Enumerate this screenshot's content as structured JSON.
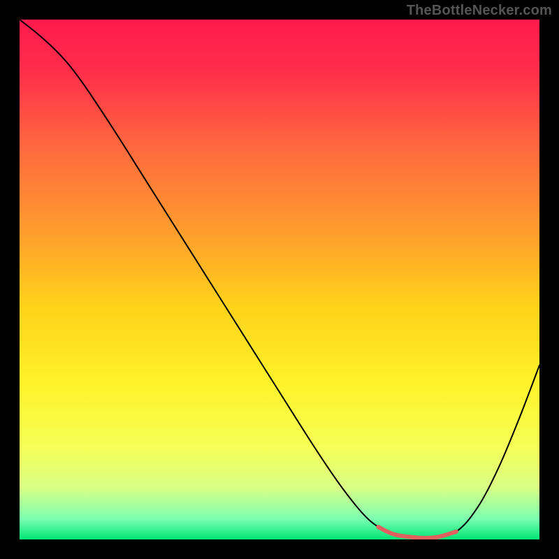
{
  "watermark": "TheBottleNecker.com",
  "chart_data": {
    "type": "line",
    "title": "",
    "xlabel": "",
    "ylabel": "",
    "xlim": [
      0,
      100
    ],
    "ylim": [
      0,
      100
    ],
    "background": {
      "gradient_stops": [
        {
          "offset": 0.0,
          "color": "#ff1a4d"
        },
        {
          "offset": 0.1,
          "color": "#ff2e4a"
        },
        {
          "offset": 0.25,
          "color": "#ff6a3e"
        },
        {
          "offset": 0.4,
          "color": "#ff9a2e"
        },
        {
          "offset": 0.55,
          "color": "#ffd21a"
        },
        {
          "offset": 0.7,
          "color": "#fff22a"
        },
        {
          "offset": 0.82,
          "color": "#f6ff55"
        },
        {
          "offset": 0.9,
          "color": "#d9ff85"
        },
        {
          "offset": 0.96,
          "color": "#7dffb0"
        },
        {
          "offset": 1.0,
          "color": "#00e676"
        }
      ]
    },
    "series": [
      {
        "name": "bottleneck-curve",
        "color": "#000000",
        "width": 2,
        "x": [
          0,
          4,
          8,
          12,
          18,
          24,
          30,
          36,
          42,
          48,
          54,
          58,
          62,
          66,
          69,
          72,
          76,
          80,
          84,
          88,
          92,
          96,
          100
        ],
        "y": [
          100,
          96.8,
          93.0,
          88.0,
          79.0,
          69.5,
          60.0,
          50.5,
          41.0,
          31.5,
          22.0,
          15.8,
          10.0,
          5.0,
          2.4,
          1.0,
          0.4,
          0.4,
          1.5,
          6.0,
          13.5,
          23.0,
          33.5
        ]
      }
    ],
    "highlight": {
      "name": "optimal-range",
      "color": "#e06060",
      "width": 6,
      "x": [
        69,
        72,
        76,
        80,
        84
      ],
      "y": [
        2.4,
        1.0,
        0.4,
        0.4,
        1.5
      ]
    }
  }
}
